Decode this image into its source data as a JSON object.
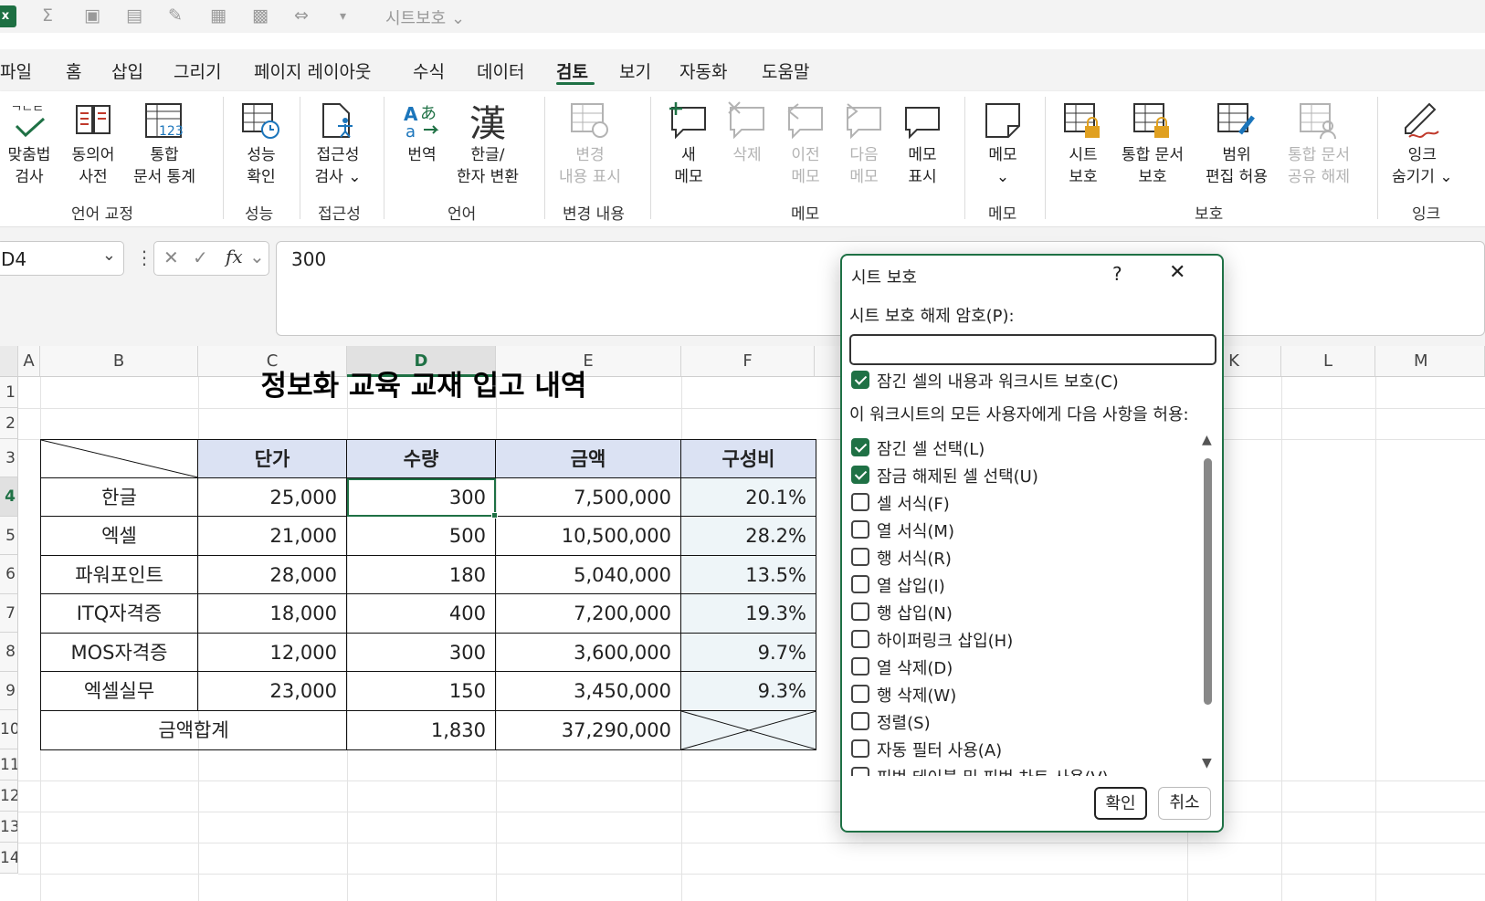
{
  "qat": {
    "title": "시트보호"
  },
  "tabs": [
    "파일",
    "홈",
    "삽입",
    "그리기",
    "페이지 레이아웃",
    "수식",
    "데이터",
    "검토",
    "보기",
    "자동화",
    "도움말"
  ],
  "active_tab": "검토",
  "ribbon": {
    "buttons": {
      "spell": "맞춤법\n검사",
      "thesaurus": "동의어\n사전",
      "stats": "통합\n문서 통계",
      "perf": "성능\n확인",
      "access": "접근성\n검사 ⌄",
      "translate": "번역",
      "hanja": "한글/\n한자 변환",
      "track": "변경\n내용 표시",
      "newnote": "새\n메모",
      "delete": "삭제",
      "prev": "이전\n메모",
      "next": "다음\n메모",
      "show": "메모\n표시",
      "memo": "메모\n⌄",
      "protsheet": "시트\n보호",
      "protwb": "통합 문서\n보호",
      "range": "범위\n편집 허용",
      "unshare": "통합 문서\n공유 해제",
      "ink": "잉크\n숨기기 ⌄"
    },
    "groups": {
      "proof": "언어 교정",
      "perf": "성능",
      "access": "접근성",
      "lang": "언어",
      "changes": "변경 내용",
      "notes": "메모",
      "memo": "메모",
      "protect": "보호",
      "ink": "잉크"
    }
  },
  "formula_bar": {
    "name_box": "D4",
    "formula": "300"
  },
  "columns": [
    "A",
    "B",
    "C",
    "D",
    "E",
    "F",
    "K",
    "L",
    "M"
  ],
  "rows": [
    "1",
    "2",
    "3",
    "4",
    "5",
    "6",
    "7",
    "8",
    "9",
    "10",
    "11",
    "12",
    "13",
    "14"
  ],
  "sheet": {
    "title": "정보화 교육 교재 입고 내역",
    "headers": [
      "단가",
      "수량",
      "금액",
      "구성비"
    ],
    "data": [
      [
        "한글",
        "25,000",
        "300",
        "7,500,000",
        "20.1%"
      ],
      [
        "엑셀",
        "21,000",
        "500",
        "10,500,000",
        "28.2%"
      ],
      [
        "파워포인트",
        "28,000",
        "180",
        "5,040,000",
        "13.5%"
      ],
      [
        "ITQ자격증",
        "18,000",
        "400",
        "7,200,000",
        "19.3%"
      ],
      [
        "MOS자격증",
        "12,000",
        "300",
        "3,600,000",
        "9.7%"
      ],
      [
        "엑셀실무",
        "23,000",
        "150",
        "3,450,000",
        "9.3%"
      ]
    ],
    "total": {
      "label": "금액합계",
      "qty": "1,830",
      "amount": "37,290,000"
    }
  },
  "dialog": {
    "title": "시트 보호",
    "help": "?",
    "password_label": "시트 보호 해제 암호(P):",
    "password_value": "",
    "protect_contents": "잠긴 셀의 내용과 워크시트 보호(C)",
    "protect_contents_checked": true,
    "allow_label": "이 워크시트의 모든 사용자에게 다음 사항을 허용:",
    "options": [
      {
        "label": "잠긴 셀 선택(L)",
        "checked": true
      },
      {
        "label": "잠금 해제된 셀 선택(U)",
        "checked": true
      },
      {
        "label": "셀 서식(F)",
        "checked": false
      },
      {
        "label": "열 서식(M)",
        "checked": false
      },
      {
        "label": "행 서식(R)",
        "checked": false
      },
      {
        "label": "열 삽입(I)",
        "checked": false
      },
      {
        "label": "행 삽입(N)",
        "checked": false
      },
      {
        "label": "하이퍼링크 삽입(H)",
        "checked": false
      },
      {
        "label": "열 삭제(D)",
        "checked": false
      },
      {
        "label": "행 삭제(W)",
        "checked": false
      },
      {
        "label": "정렬(S)",
        "checked": false
      },
      {
        "label": "자동 필터 사용(A)",
        "checked": false
      },
      {
        "label": "피벗 테이블 및 피벗 차트 사용(V)",
        "checked": false
      }
    ],
    "ok": "확인",
    "cancel": "취소"
  },
  "colors": {
    "accent": "#1f7145",
    "header_fill": "#dbe2f3",
    "ratio_fill": "#eef5f8"
  }
}
